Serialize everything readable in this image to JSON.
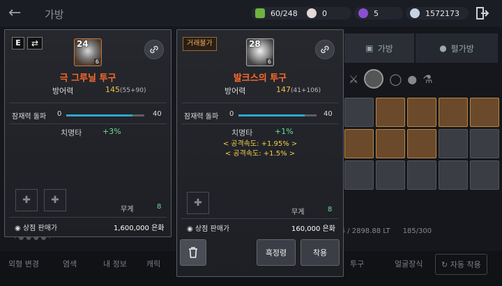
{
  "header": {
    "title": "가방",
    "back_icon": "back-arrow-icon"
  },
  "resources": [
    {
      "name": "green",
      "value": "60/248",
      "color": "#6fb33f"
    },
    {
      "name": "pearl",
      "value": "0",
      "color": "#e6d9d6"
    },
    {
      "name": "purple",
      "value": "5",
      "color": "#8a4fd1"
    },
    {
      "name": "silver",
      "value": "1572173",
      "color": "#c7d3e0"
    }
  ],
  "background": {
    "tab_bag": "가방",
    "tab_pet": "펄가방",
    "status_weight": "1133.4 / 2898.88 LT",
    "status_slots": "185/300",
    "bottom": [
      "외형 변경",
      "염색",
      "내 정보",
      "캐릭",
      "투구",
      "얼굴장식",
      "자동 착용"
    ]
  },
  "left_item": {
    "tag_e": "E",
    "level": "24",
    "grade": "6",
    "name": "극 그루닐 투구",
    "def_label": "방어력",
    "def_value": "145",
    "def_detail": "(55+90)",
    "bar_label": "잠재력 돌파",
    "bar_min": "0",
    "bar_max": "40",
    "bar_fill": 0.85,
    "crit_label": "치명타",
    "crit_value": "+3%",
    "weight_label": "무게",
    "weight_value": "8",
    "price_label": "상점 판매가",
    "price_value": "1,600,000 은화"
  },
  "right_item": {
    "tag": "거래불가",
    "level": "28",
    "grade": "6",
    "name": "발크스의 투구",
    "def_label": "방어력",
    "def_value": "147",
    "def_detail": "(41+106)",
    "bar_label": "잠재력 돌파",
    "bar_min": "0",
    "bar_max": "40",
    "bar_fill": 0.85,
    "crit_label": "치명타",
    "crit_value": "+1%",
    "bonus1": "< 공격속도: +1.95% >",
    "bonus2": "< 공격속도: +1.5% >",
    "weight_label": "무게",
    "weight_value": "8",
    "price_label": "상점 판매가",
    "price_value": "160,000 은화"
  },
  "actions": {
    "delete_icon": "trash-icon",
    "appraise": "흑정령",
    "equip": "착용"
  }
}
